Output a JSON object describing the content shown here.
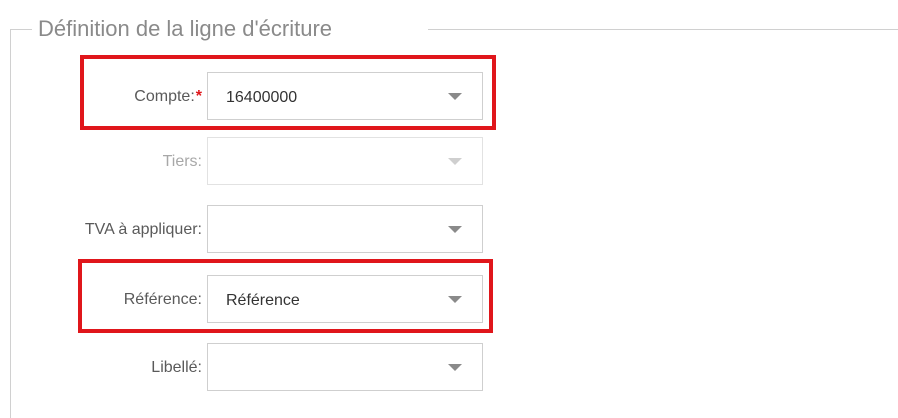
{
  "section": {
    "legend": "Définition de la ligne d'écriture"
  },
  "fields": {
    "compte": {
      "label": "Compte:",
      "required_mark": "*",
      "value": "16400000"
    },
    "tiers": {
      "label": "Tiers:",
      "value": ""
    },
    "tva": {
      "label": "TVA à appliquer:",
      "value": ""
    },
    "reference": {
      "label": "Référence:",
      "value": "Référence"
    },
    "libelle": {
      "label": "Libellé:",
      "value": ""
    }
  },
  "colors": {
    "highlight": "#e0161b",
    "required": "#e0161b",
    "border": "#cfcfcf",
    "legend": "#8a8a8a"
  },
  "icons": {
    "dropdown": "chevron-down-icon"
  }
}
